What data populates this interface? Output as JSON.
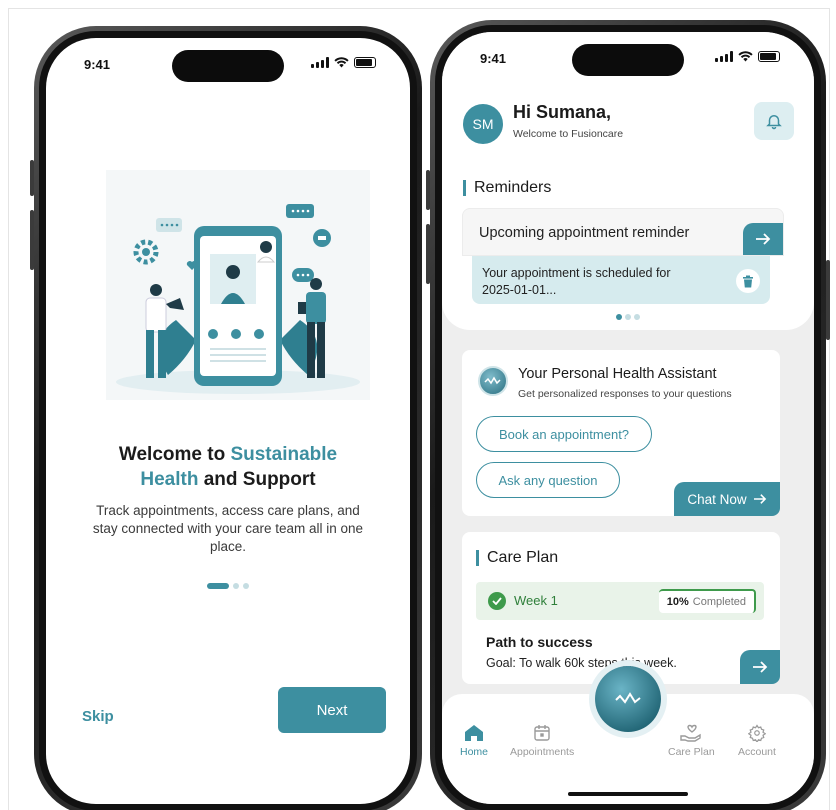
{
  "left_screen": {
    "status_time": "9:41",
    "title_part1": "Welcome to ",
    "title_accent1": "Sustainable",
    "title_accent2": "Health",
    "title_part2": " and Support",
    "subtitle": "Track appointments, access care plans, and stay connected with your care team all in one place.",
    "pagination": {
      "total": 3,
      "active": 1
    },
    "skip_label": "Skip",
    "next_label": "Next"
  },
  "right_screen": {
    "status_time": "9:41",
    "avatar_initials": "SM",
    "greeting": "Hi Sumana,",
    "greeting_sub": "Welcome to Fusioncare",
    "reminders": {
      "section_title": "Reminders",
      "card_title": "Upcoming appointment reminder",
      "card_body": "Your appointment is scheduled for 2025-01-01...",
      "pagination": {
        "total": 3,
        "active": 1
      }
    },
    "assistant": {
      "title": "Your Personal Health Assistant",
      "subtitle": "Get personalized responses to your questions",
      "option1": "Book an appointment?",
      "option2": "Ask any question",
      "chat_now_label": "Chat Now"
    },
    "care_plan": {
      "section_title": "Care Plan",
      "week_label": "Week 1",
      "progress_percent": "10%",
      "progress_label": "Completed",
      "path_title": "Path to success",
      "goal": "Goal: To walk 60k steps this week."
    },
    "tabs": [
      {
        "label": "Home",
        "icon": "home-icon",
        "active": true
      },
      {
        "label": "Appointments",
        "icon": "calendar-icon",
        "active": false
      },
      {
        "label": "Care Plan",
        "icon": "care-hand-icon",
        "active": false
      },
      {
        "label": "Account",
        "icon": "gear-icon",
        "active": false
      }
    ]
  },
  "colors": {
    "accent": "#3d8fa0",
    "accent_light": "#d6ebee",
    "success": "#3e9a4b",
    "text_dark": "#1b1b1b"
  }
}
